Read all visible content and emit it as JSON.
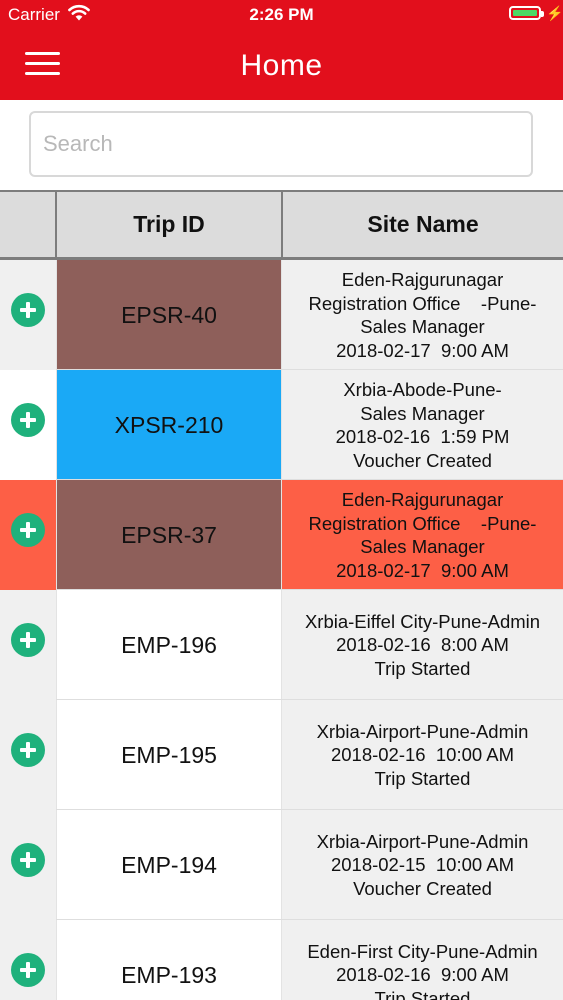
{
  "status_bar": {
    "carrier": "Carrier",
    "time": "2:26 PM"
  },
  "nav": {
    "title": "Home",
    "menu_icon": "hamburger-menu-icon"
  },
  "search": {
    "placeholder": "Search",
    "value": ""
  },
  "table": {
    "headers": {
      "expand": "",
      "trip_id": "Trip ID",
      "site_name": "Site Name"
    },
    "rows": [
      {
        "trip_id": "EPSR-40",
        "site_lines": [
          "Eden-Rajgurunagar",
          "Registration Office    -Pune-",
          "Sales Manager",
          "2018-02-17  9:00 AM"
        ],
        "trip_bg": "#8e5f5a",
        "site_bg": "#f0f0f0",
        "expand_bg": "#f0f0f0"
      },
      {
        "trip_id": "XPSR-210",
        "site_lines": [
          "Xrbia-Abode-Pune-",
          "Sales Manager",
          "2018-02-16  1:59 PM",
          "Voucher Created"
        ],
        "trip_bg": "#1aa9f6",
        "site_bg": "#f0f0f0",
        "expand_bg": "#ffffff"
      },
      {
        "trip_id": "EPSR-37",
        "site_lines": [
          "Eden-Rajgurunagar",
          "Registration Office    -Pune-",
          "Sales Manager",
          "2018-02-17  9:00 AM"
        ],
        "trip_bg": "#8e5f5a",
        "site_bg": "#fd5f46",
        "expand_bg": "#fd5f46"
      },
      {
        "trip_id": "EMP-196",
        "site_lines": [
          "Xrbia-Eiffel City-Pune-Admin",
          "2018-02-16  8:00 AM",
          "Trip Started"
        ],
        "trip_bg": "#ffffff",
        "site_bg": "#f0f0f0",
        "expand_bg": "#f0f0f0"
      },
      {
        "trip_id": "EMP-195",
        "site_lines": [
          "Xrbia-Airport-Pune-Admin",
          "2018-02-16  10:00 AM",
          "Trip Started"
        ],
        "trip_bg": "#ffffff",
        "site_bg": "#f0f0f0",
        "expand_bg": "#f0f0f0"
      },
      {
        "trip_id": "EMP-194",
        "site_lines": [
          "Xrbia-Airport-Pune-Admin",
          "2018-02-15  10:00 AM",
          "Voucher Created"
        ],
        "trip_bg": "#ffffff",
        "site_bg": "#f0f0f0",
        "expand_bg": "#f0f0f0"
      },
      {
        "trip_id": "EMP-193",
        "site_lines": [
          "Eden-First City-Pune-Admin",
          "2018-02-16  9:00 AM",
          "Trip Started"
        ],
        "trip_bg": "#ffffff",
        "site_bg": "#f0f0f0",
        "expand_bg": "#f0f0f0"
      }
    ]
  },
  "colors": {
    "header_red": "#e20f1c",
    "add_green": "#1fb17c",
    "battery_green": "#4cd964"
  }
}
